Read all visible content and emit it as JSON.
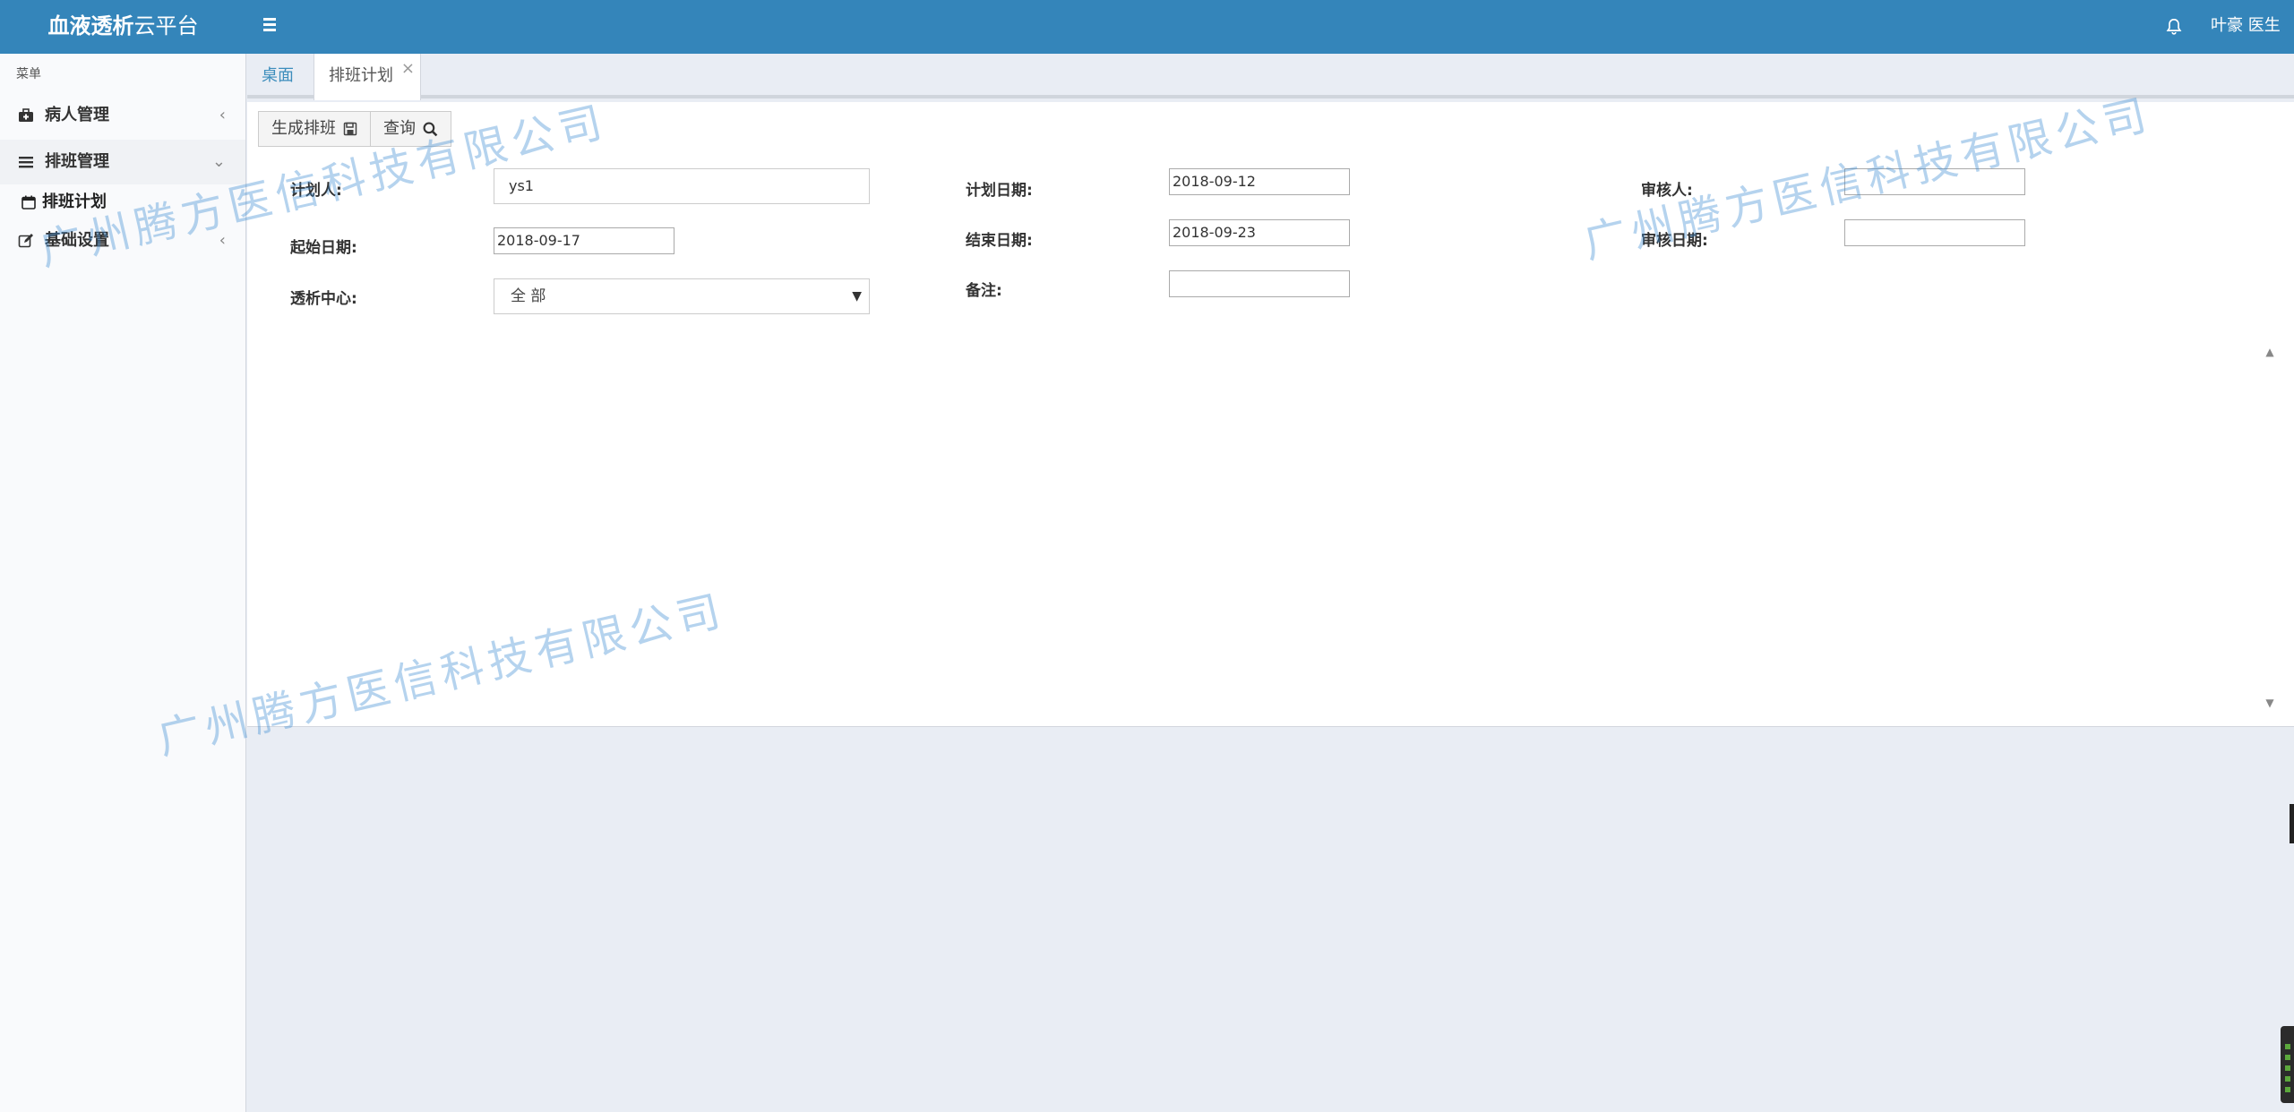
{
  "header": {
    "brand_bold": "血液透析",
    "brand_rest": "云平台",
    "user": "叶豪 医生",
    "bg_color": "#3485ba"
  },
  "sidebar": {
    "header": "菜单",
    "items": [
      {
        "label": "病人管理",
        "icon": "briefcase-medical-icon",
        "arrow": "‹"
      },
      {
        "label": "排班管理",
        "icon": "list-icon",
        "arrow": "⌄"
      },
      {
        "label": "基础设置",
        "icon": "edit-icon",
        "arrow": "‹"
      }
    ],
    "subitem": {
      "label": "排班计划",
      "icon": "calendar-icon"
    }
  },
  "tabs": [
    {
      "label": "桌面"
    },
    {
      "label": "排班计划",
      "close": "×"
    }
  ],
  "toolbar": {
    "generate_label": "生成排班",
    "query_label": "查询"
  },
  "form": {
    "planner_label": "计划人:",
    "planner_value": "ys1",
    "plan_date_label": "计划日期:",
    "plan_date_value": "2018-09-12",
    "reviewer_label": "审核人:",
    "reviewer_value": "",
    "start_date_label": "起始日期:",
    "start_date_value": "2018-09-17",
    "end_date_label": "结束日期:",
    "end_date_value": "2018-09-23",
    "review_date_label": "审核日期:",
    "review_date_value": "",
    "center_label": "透析中心:",
    "center_value": "全 部",
    "remark_label": "备注:",
    "remark_value": ""
  },
  "watermark": "广州腾方医信科技有限公司"
}
